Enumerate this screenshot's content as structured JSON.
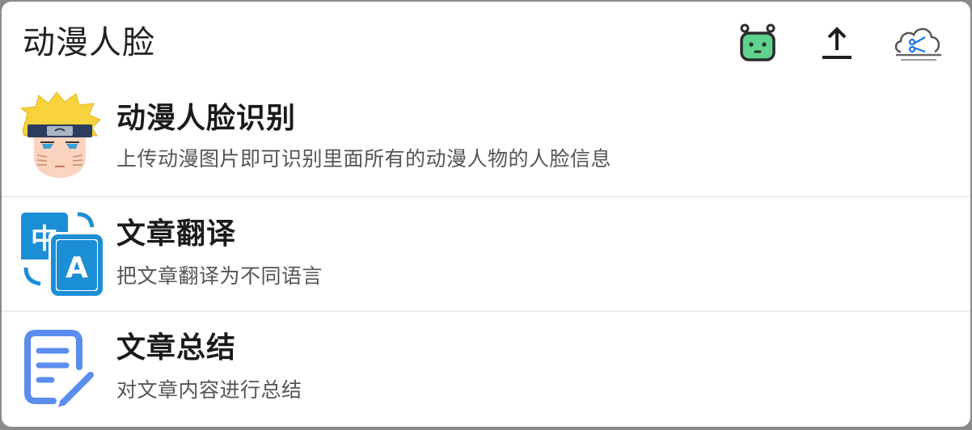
{
  "header": {
    "title": "动漫人脸",
    "icons": [
      "robot-icon",
      "upload-icon",
      "cloud-cut-icon"
    ]
  },
  "items": [
    {
      "title": "动漫人脸识别",
      "desc": "上传动漫图片即可识别里面所有的动漫人物的人脸信息",
      "icon": "anime-face-icon"
    },
    {
      "title": "文章翻译",
      "desc": "把文章翻译为不同语言",
      "icon": "translate-icon"
    },
    {
      "title": "文章总结",
      "desc": "对文章内容进行总结",
      "icon": "edit-document-icon"
    }
  ],
  "colors": {
    "translate_blue": "#1b8ed6",
    "document_blue": "#5b8def",
    "robot_green": "#5fd38d",
    "cloud_blue": "#1a73e8"
  }
}
